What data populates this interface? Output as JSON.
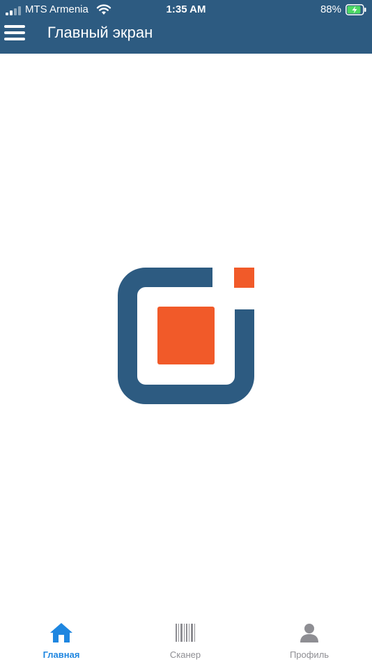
{
  "status_bar": {
    "carrier": "MTS Armenia",
    "time": "1:35 AM",
    "battery_percent": "88%",
    "battery_level": 0.88,
    "icons": [
      "signal-icon",
      "wifi-icon",
      "battery-charging-icon"
    ]
  },
  "header": {
    "title": "Главный экран",
    "menu_icon": "hamburger-menu-icon"
  },
  "main": {
    "logo": "brand-logo"
  },
  "tabbar": {
    "tabs": [
      {
        "label": "Главная",
        "icon": "home-icon",
        "active": true
      },
      {
        "label": "Сканер",
        "icon": "barcode-icon",
        "active": false
      },
      {
        "label": "Профиль",
        "icon": "profile-icon",
        "active": false
      }
    ]
  },
  "colors": {
    "header_bg": "#2d5b81",
    "logo_blue": "#2d5b81",
    "logo_orange": "#f15a29",
    "active_tab": "#1e86e0",
    "inactive_tab": "#8e8e93"
  }
}
